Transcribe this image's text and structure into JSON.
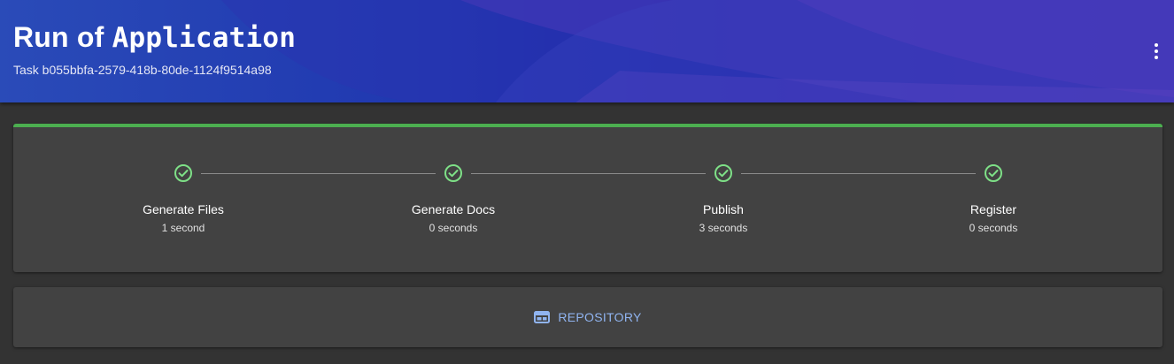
{
  "header": {
    "title_prefix": "Run of",
    "title_name": "Application",
    "subtitle": "Task b055bbfa-2579-418b-80de-1124f9514a98",
    "menu_icon": "more-vert-icon"
  },
  "progress": {
    "status_color": "#4caf50",
    "steps": [
      {
        "label": "Generate Files",
        "duration": "1 second",
        "icon": "check-circle-icon"
      },
      {
        "label": "Generate Docs",
        "duration": "0 seconds",
        "icon": "check-circle-icon"
      },
      {
        "label": "Publish",
        "duration": "3 seconds",
        "icon": "check-circle-icon"
      },
      {
        "label": "Register",
        "duration": "0 seconds",
        "icon": "check-circle-icon"
      }
    ]
  },
  "links": {
    "repository_label": "REPOSITORY",
    "repository_icon": "web-window-icon"
  },
  "colors": {
    "accent": "#90b4f0",
    "success": "#4caf50",
    "check": "#7ee087"
  }
}
